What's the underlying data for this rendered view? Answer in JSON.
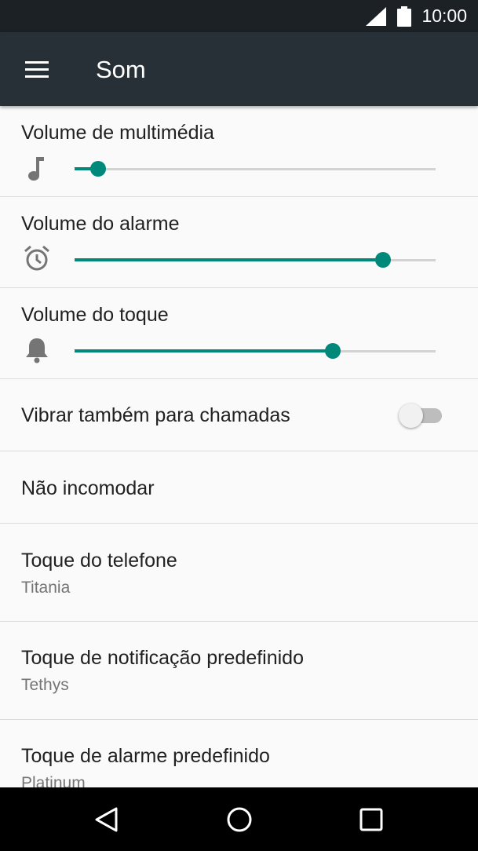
{
  "status_bar": {
    "time": "10:00"
  },
  "app_bar": {
    "title": "Som"
  },
  "sliders": [
    {
      "label": "Volume de multimédia",
      "icon": "music-note-icon",
      "level": 0.065
    },
    {
      "label": "Volume do alarme",
      "icon": "alarm-clock-icon",
      "level": 0.855
    },
    {
      "label": "Volume do toque",
      "icon": "bell-icon",
      "level": 0.715
    }
  ],
  "vibrate": {
    "label": "Vibrar também para chamadas",
    "enabled": false
  },
  "settings": [
    {
      "title": "Não incomodar"
    },
    {
      "title": "Toque do telefone",
      "subtitle": "Titania"
    },
    {
      "title": "Toque de notificação predefinido",
      "subtitle": "Tethys"
    },
    {
      "title": "Toque de alarme predefinido",
      "subtitle": "Platinum"
    }
  ],
  "colors": {
    "accent": "#00897b",
    "app_bar": "#283037",
    "status_bar": "#1c2126"
  }
}
